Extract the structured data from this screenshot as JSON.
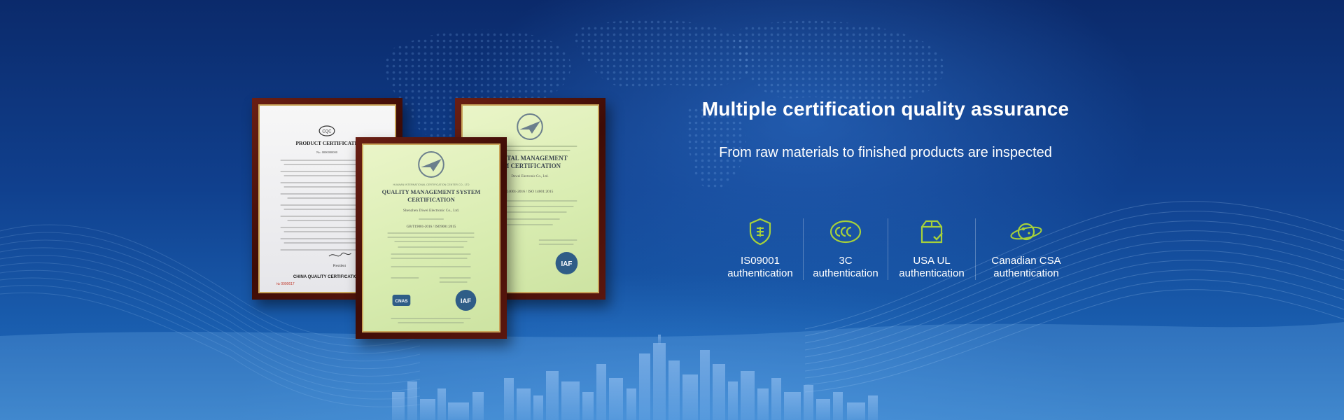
{
  "headline": "Multiple certification quality assurance",
  "subline": "From raw materials to finished products are inspected",
  "features": [
    {
      "label": "IS09001\nauthentication",
      "icon": "shield-certificate-icon"
    },
    {
      "label": "3C\nauthentication",
      "icon": "ccc-mark-icon"
    },
    {
      "label": "USA UL\nauthentication",
      "icon": "box-check-icon"
    },
    {
      "label": "Canadian CSA\nauthentication",
      "icon": "planet-icon"
    }
  ],
  "certificates": {
    "left": {
      "logo": "CQC",
      "title": "PRODUCT CERTIFICATE",
      "number": "No. 0000000000",
      "signature_title": "President",
      "issuer": "CHINA QUALITY CERTIFICATION C",
      "serial": "№ 0000617"
    },
    "front": {
      "header": "HUANAN INTERNATIONAL CERTIFICATION CENTER CO., LTD",
      "title_line1": "QUALITY MANAGEMENT SYSTEM",
      "title_line2": "CERTIFICATION",
      "company": "Shenzhen Diwei Electronic Co., Ltd.",
      "standard": "GB/T19001-2016 / ISO9001:2015",
      "badge_left": "CNAS",
      "badge_right": "IAF"
    },
    "back": {
      "title_line1": "MENTAL MANAGEMENT",
      "title_line2": "EM CERTIFICATION",
      "company": "Dewei Electronic Co., Ltd.",
      "standard": "24001-2016 / ISO 14001:2015",
      "badge_right": "IAF"
    }
  },
  "colors": {
    "accent_green": "#a6d13a",
    "text": "#ffffff"
  }
}
